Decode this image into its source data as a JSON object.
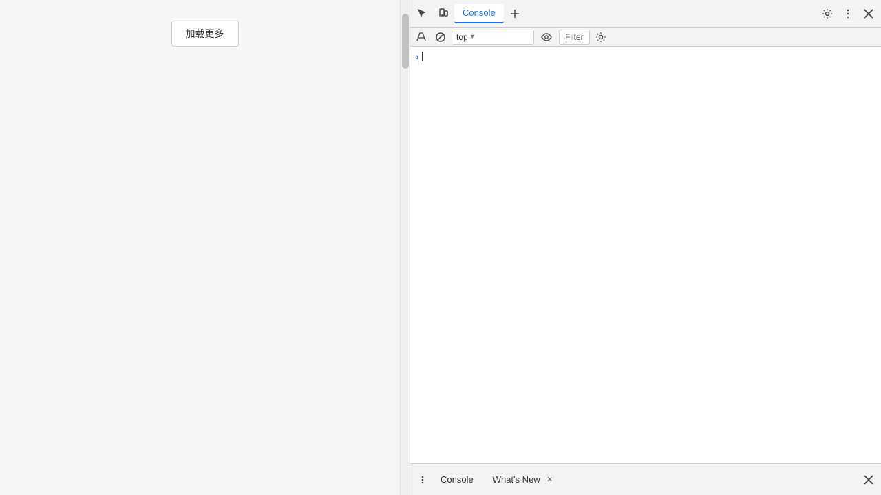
{
  "leftPanel": {
    "loadMoreButton": "加载更多"
  },
  "devtools": {
    "toolbar": {
      "inspectLabel": "Inspect",
      "deviceLabel": "Device",
      "consoleTab": "Console",
      "moreTabsLabel": "More tabs",
      "settingsLabel": "Settings",
      "moreActionsLabel": "More actions",
      "closeLabel": "Close DevTools"
    },
    "consoleToolbar": {
      "clearLabel": "Clear console",
      "blockLabel": "Block requests",
      "contextValue": "top",
      "contextDropdownArrow": "▾",
      "eyeLabel": "Live expressions",
      "filterLabel": "Filter",
      "settingsLabel": "Console settings"
    },
    "consoleContent": {
      "promptSymbol": "›"
    },
    "bottomDrawer": {
      "menuLabel": "More options",
      "consoleTabLabel": "Console",
      "whatsNewTabLabel": "What's New",
      "whatsNewCloseLabel": "✕",
      "closeDrawerLabel": "Close drawer"
    }
  }
}
